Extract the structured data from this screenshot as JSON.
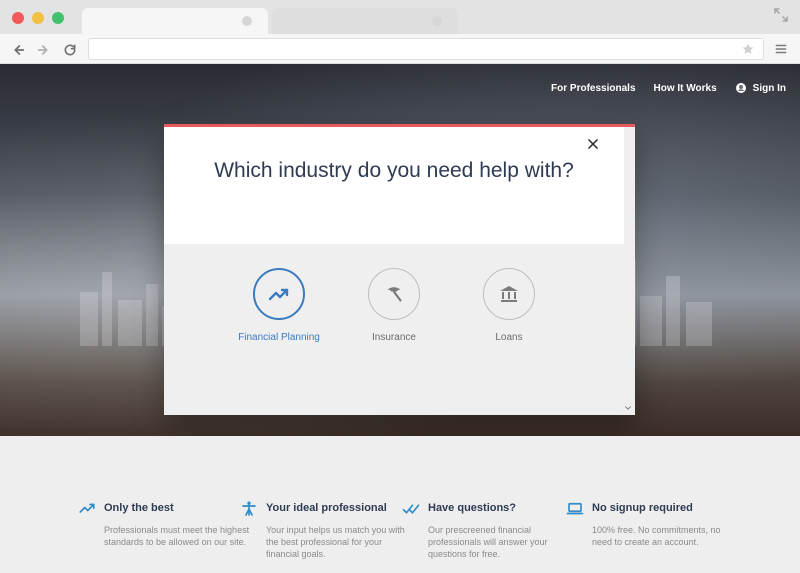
{
  "browser": {
    "tabs": [
      {
        "label": ""
      },
      {
        "label": ""
      }
    ],
    "address_value": ""
  },
  "header": {
    "nav": [
      {
        "label": "For Professionals"
      },
      {
        "label": "How It Works"
      },
      {
        "label": "Sign In"
      }
    ]
  },
  "modal": {
    "title": "Which industry do you need help with?",
    "options": [
      {
        "label": "Financial Planning",
        "icon": "trending-up-icon",
        "selected": true
      },
      {
        "label": "Insurance",
        "icon": "umbrella-icon",
        "selected": false
      },
      {
        "label": "Loans",
        "icon": "bank-icon",
        "selected": false
      }
    ],
    "accent_color": "#e9595b",
    "selected_color": "#3b7bbf"
  },
  "features": [
    {
      "title": "Only the best",
      "icon": "trending-up-icon",
      "body": "Professionals must meet the highest standards to be allowed on our site."
    },
    {
      "title": "Your ideal professional",
      "icon": "person-icon",
      "body": "Your input helps us match you with the best professional for your financial goals."
    },
    {
      "title": "Have questions?",
      "icon": "double-check-icon",
      "body": "Our prescreened financial professionals will answer your questions for free."
    },
    {
      "title": "No signup required",
      "icon": "laptop-icon",
      "body": "100% free. No commitments, no need to create an account."
    }
  ]
}
